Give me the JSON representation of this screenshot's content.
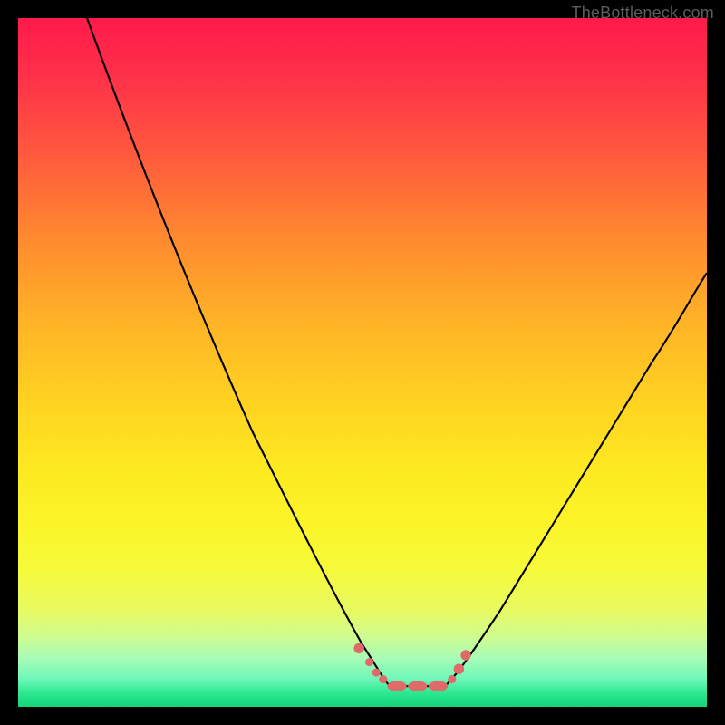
{
  "watermark": "TheBottleneck.com",
  "colors": {
    "frame": "#000000",
    "curve": "#000000",
    "marker": "#e06a6a",
    "gradient_top": "#ff1a4a",
    "gradient_bottom": "#12d479"
  },
  "chart_data": {
    "type": "line",
    "title": "",
    "xlabel": "",
    "ylabel": "",
    "xlim": [
      0,
      100
    ],
    "ylim": [
      0,
      100
    ],
    "grid": false,
    "legend": false,
    "series": [
      {
        "name": "left-curve",
        "x": [
          10,
          15,
          20,
          25,
          30,
          35,
          40,
          45,
          48,
          50,
          52,
          54
        ],
        "y": [
          100,
          84,
          69,
          55,
          43,
          32,
          22,
          14,
          10,
          7,
          5,
          3
        ]
      },
      {
        "name": "right-curve",
        "x": [
          62,
          64,
          66,
          70,
          75,
          80,
          85,
          90,
          95,
          100
        ],
        "y": [
          3,
          5,
          8,
          14,
          23,
          32,
          41,
          49,
          57,
          63
        ]
      },
      {
        "name": "floor",
        "x": [
          54,
          56,
          58,
          60,
          62
        ],
        "y": [
          3,
          3,
          3,
          3,
          3
        ]
      }
    ],
    "markers": {
      "name": "highlight-dots",
      "x": [
        49.5,
        51,
        52,
        53,
        54,
        56,
        58,
        60,
        62,
        63,
        64,
        65
      ],
      "y": [
        8.5,
        6.5,
        5,
        4,
        3,
        3,
        3,
        3,
        3,
        4,
        5.5,
        7.5
      ],
      "r": [
        5,
        4,
        4,
        4,
        5,
        5,
        5,
        5,
        5,
        4,
        5,
        5
      ]
    }
  }
}
